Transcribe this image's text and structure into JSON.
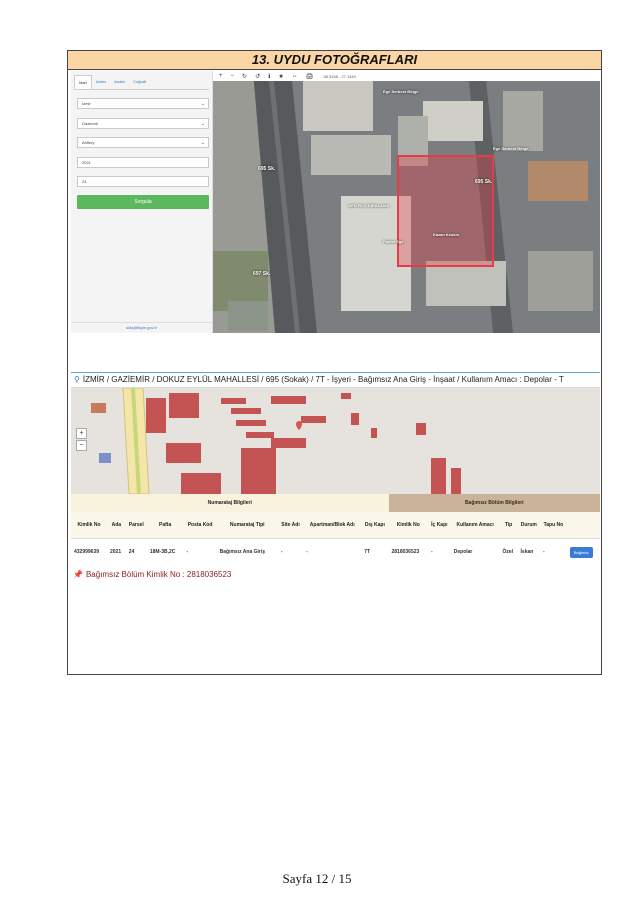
{
  "section_title": "13. UYDU FOTOĞRAFLARI",
  "query_panel": {
    "tabs": [
      "İdari",
      "Adres",
      "Analiz",
      "Coğrafi"
    ],
    "fields": [
      "İzmir",
      "Gaziemir",
      "Atıfbey",
      "2021",
      "24"
    ],
    "button": "Sorgula",
    "footer": "ulas@tkgm.gov.tr"
  },
  "satellite": {
    "toolbar_icons": [
      "+",
      "−",
      "↻",
      "↺",
      "ℹ",
      "★",
      "↔",
      "🖨"
    ],
    "coordinates": "38.3158 - 27.1440",
    "labels": [
      "Ege Serbest Bölge",
      "Ege Serbest Bölge",
      "GEN FİLO KİRALAMA",
      "Postel Ege",
      "Kazan Keskin"
    ],
    "roads": [
      "695 Sk.",
      "697 Sk.",
      "695 Sk."
    ]
  },
  "address": {
    "text": "İZMİR / GAZİEMİR / DOKUZ EYLÜL MAHALLESİ / 695 (Sokak) / 7T - İşyeri - Bağımsız Ana Giriş - İnşaat / Kullanım Amacı : Depolar - T"
  },
  "table": {
    "group_left": "Numarataj Bilgileri",
    "group_right": "Bağımsız Bölüm Bilgileri",
    "headers": [
      "Kimlik No",
      "Ada",
      "Parsel",
      "Pafta",
      "Posta Kod",
      "Numarataj Tipi",
      "Site Adı",
      "Apartman/Blok Adı",
      "Dış Kapı",
      "Kimlik No",
      "İç Kapı",
      "Kullanım Amacı",
      "Tip",
      "Durum",
      "Tapu No",
      ""
    ],
    "row": [
      "432999639",
      "2021",
      "24",
      "18M-3B,2C",
      "-",
      "Bağımsız Ana Giriş",
      "-",
      "-",
      "7T",
      "2818036523",
      "-",
      "Depolar",
      "Özel",
      "İskan",
      "-"
    ],
    "button": "Bağımla"
  },
  "bb_title": "Bağımsız Bölüm Kimlik No : 2818036523",
  "page_number": "Sayfa 12 / 15",
  "colors": {
    "title_bg": "#fcd5a5",
    "query_button": "#5cb85c",
    "highlight_parcel": "#e43c48",
    "link_button": "#3a7bd5"
  }
}
